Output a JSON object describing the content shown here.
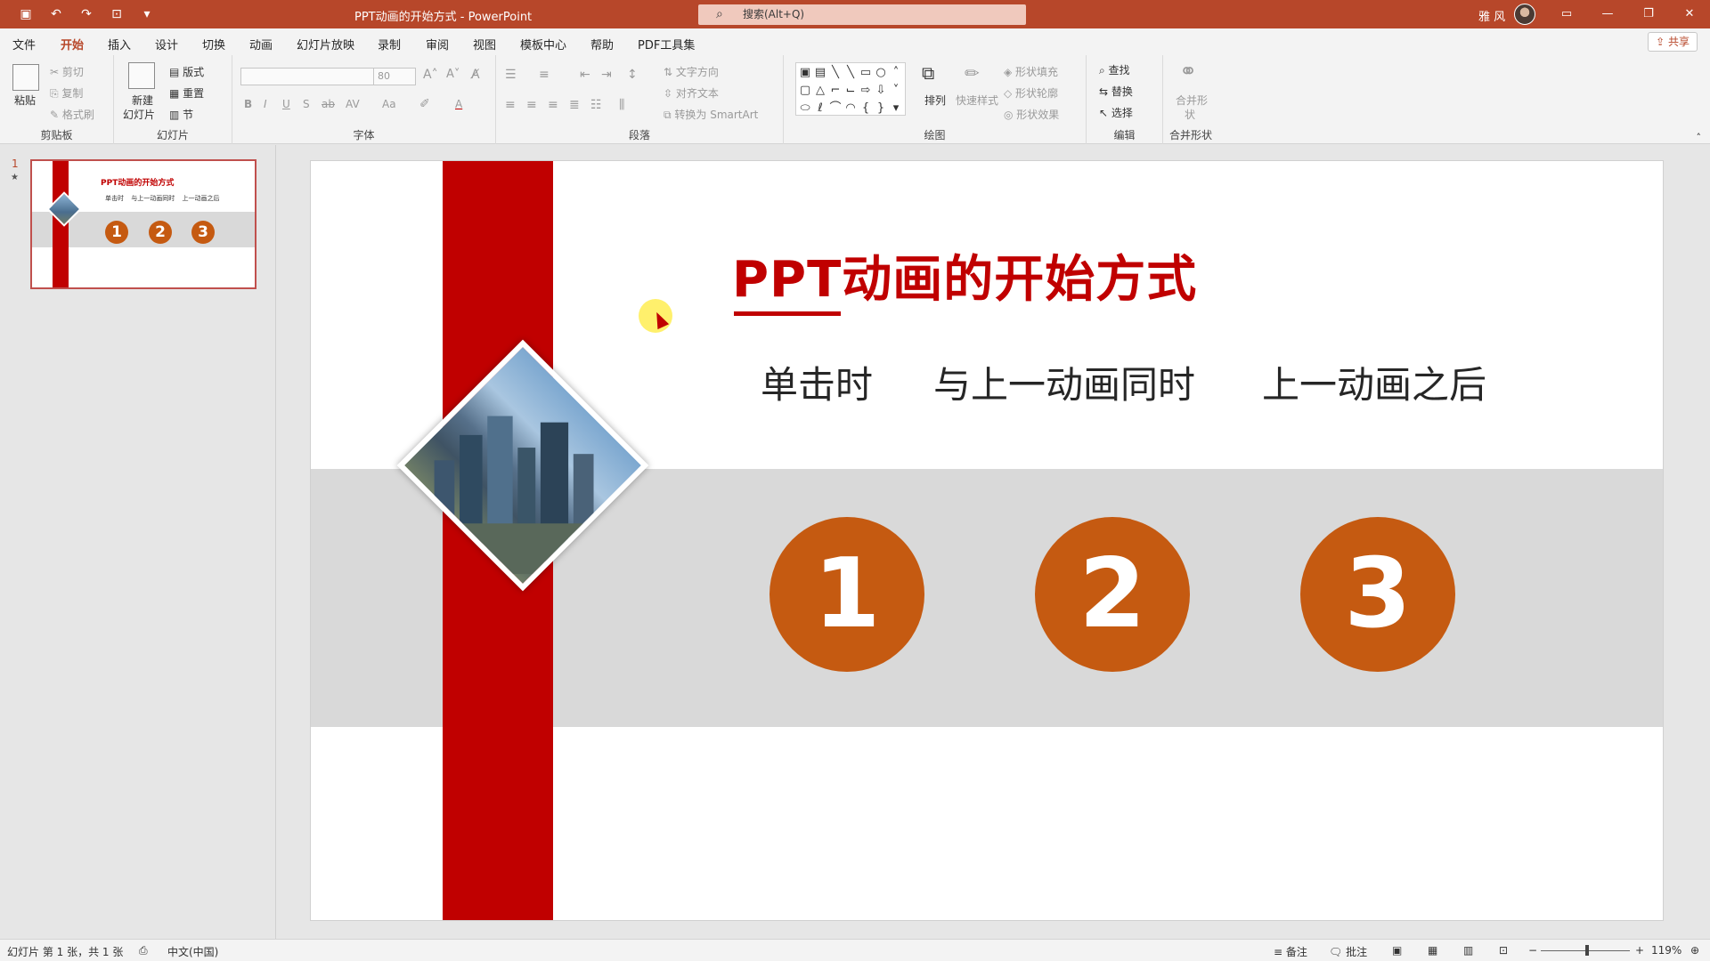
{
  "titlebar": {
    "doc_title": "PPT动画的开始方式  -  PowerPoint",
    "search_placeholder": "搜索(Alt+Q)",
    "user_name": "雅 风",
    "qat": [
      "save-icon",
      "undo-icon",
      "redo-icon",
      "present-icon",
      "customize-icon"
    ]
  },
  "menu": {
    "tabs": [
      "文件",
      "开始",
      "插入",
      "设计",
      "切换",
      "动画",
      "幻灯片放映",
      "录制",
      "审阅",
      "视图",
      "模板中心",
      "帮助",
      "PDF工具集"
    ],
    "active_tab": "开始",
    "share": "共享"
  },
  "ribbon": {
    "clipboard": {
      "label": "剪贴板",
      "paste": "粘贴",
      "cut": "剪切",
      "copy": "复制",
      "format_painter": "格式刷"
    },
    "slides": {
      "label": "幻灯片",
      "new_slide": "新建",
      "new_slide2": "幻灯片",
      "layout": "版式",
      "reset": "重置",
      "section": "节"
    },
    "font": {
      "label": "字体",
      "size": "80"
    },
    "paragraph": {
      "label": "段落",
      "text_direction": "文字方向",
      "align_text": "对齐文本",
      "smartart": "转换为 SmartArt"
    },
    "drawing": {
      "label": "绘图",
      "arrange": "排列",
      "quick_styles": "快速样式",
      "shape_fill": "形状填充",
      "shape_outline": "形状轮廓",
      "shape_effects": "形状效果"
    },
    "editing": {
      "label": "编辑",
      "find": "查找",
      "replace": "替换",
      "select": "选择"
    },
    "merge": {
      "label": "合并形状",
      "merge_btn": "合并形",
      "merge_btn2": "状"
    }
  },
  "thumbnail": {
    "number": "1",
    "title": "PPT动画的开始方式",
    "subtitle": "单击时    与上一动画同时    上一动画之后",
    "circles": [
      "1",
      "2",
      "3"
    ]
  },
  "slide": {
    "title": "PPT动画的开始方式",
    "options": [
      "单击时",
      "与上一动画同时",
      "上一动画之后"
    ],
    "numbers": [
      "1",
      "2",
      "3"
    ],
    "colors": {
      "accent_red": "#c00000",
      "circle_orange": "#c55a11",
      "band_gray": "#d9d9d9"
    }
  },
  "status": {
    "slide_info": "幻灯片 第 1 张，共 1 张",
    "language": "中文(中国)",
    "notes": "备注",
    "comments": "批注",
    "zoom": "119%"
  }
}
